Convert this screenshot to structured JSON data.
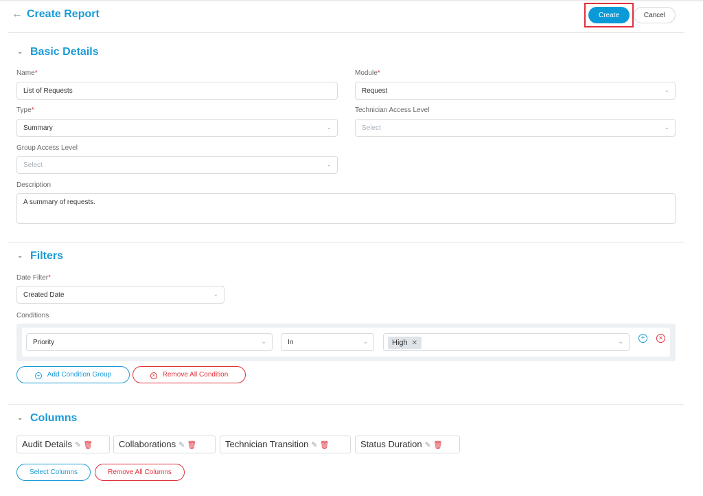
{
  "header": {
    "title": "Create Report",
    "back_icon": "←",
    "create_label": "Create",
    "cancel_label": "Cancel"
  },
  "basic": {
    "title": "Basic Details",
    "name_label": "Name",
    "name_value": "List of Requests",
    "module_label": "Module",
    "module_value": "Request",
    "type_label": "Type",
    "type_value": "Summary",
    "tech_label": "Technician Access Level",
    "tech_placeholder": "Select",
    "group_label": "Group Access Level",
    "group_placeholder": "Select",
    "desc_label": "Description",
    "desc_value": "A summary of requests."
  },
  "filters": {
    "title": "Filters",
    "date_label": "Date Filter",
    "date_value": "Created Date",
    "conditions_label": "Conditions",
    "cond_field": "Priority",
    "cond_op": "In",
    "cond_chip": "High",
    "add_group_label": "Add Condition Group",
    "remove_all_label": "Remove All Condition"
  },
  "columns": {
    "title": "Columns",
    "items": [
      "Audit Details",
      "Collaborations",
      "Technician Transition",
      "Status Duration"
    ],
    "select_label": "Select Columns",
    "remove_all_label": "Remove All Columns"
  },
  "required_mark": "*",
  "colors": {
    "accent": "#1a9bd7",
    "danger": "#e0303a"
  }
}
